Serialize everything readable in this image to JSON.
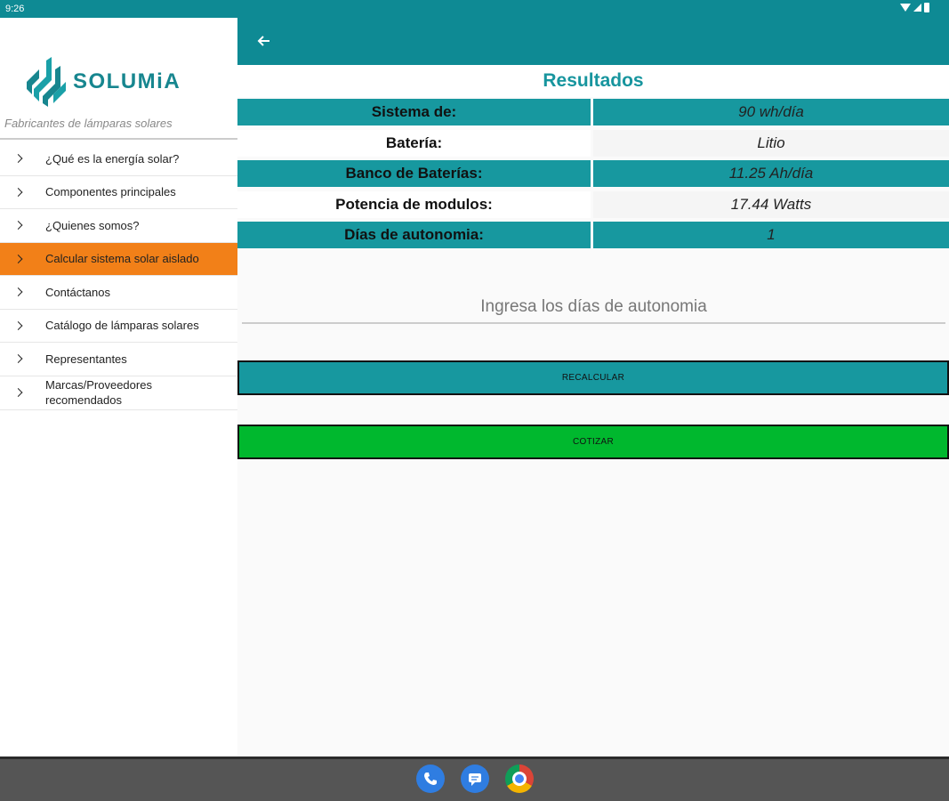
{
  "status_bar": {
    "time": "9:26"
  },
  "drawer": {
    "brand": "SOLUMiA",
    "tagline": "Fabricantes de lámparas solares",
    "items": [
      {
        "label": "¿Qué es la energía solar?"
      },
      {
        "label": "Componentes principales"
      },
      {
        "label": "¿Quienes somos?"
      },
      {
        "label": "Calcular sistema solar aislado",
        "active": true
      },
      {
        "label": "Contáctanos"
      },
      {
        "label": "Catálogo de lámparas solares"
      },
      {
        "label": "Representantes"
      },
      {
        "label": "Marcas/Proveedores recomendados"
      }
    ]
  },
  "main": {
    "title": "Resultados",
    "rows": [
      {
        "label": "Sistema de:",
        "value": "90 wh/día"
      },
      {
        "label": "Batería:",
        "value": "Litio"
      },
      {
        "label": "Banco de Baterías:",
        "value": "11.25 Ah/día"
      },
      {
        "label": "Potencia de modulos:",
        "value": "17.44 Watts"
      },
      {
        "label": "Días de autonomia:",
        "value": "1"
      }
    ],
    "input_placeholder": "Ingresa los días de autonomia",
    "recalc_label": "RECALCULAR",
    "cotizar_label": "COTIZAR"
  },
  "colors": {
    "primary": "#0e8a94",
    "accent": "#f28018",
    "cotizar": "#00b82e"
  },
  "icons": {
    "back": "arrow-back-icon",
    "menu_chevron": "chevron-right-icon",
    "dock": [
      "phone-icon",
      "messages-icon",
      "chrome-icon"
    ]
  }
}
